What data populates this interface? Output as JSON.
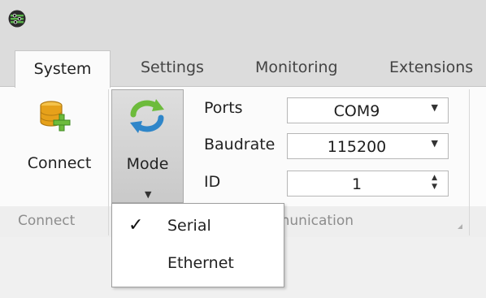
{
  "tabs": [
    {
      "label": "System",
      "active": true
    },
    {
      "label": "Settings",
      "active": false
    },
    {
      "label": "Monitoring",
      "active": false
    },
    {
      "label": "Extensions",
      "active": false
    }
  ],
  "ribbon": {
    "connect_label": "Connect",
    "mode_label": "Mode",
    "fields": {
      "ports": {
        "label": "Ports",
        "value": "COM9"
      },
      "baudrate": {
        "label": "Baudrate",
        "value": "115200"
      },
      "id": {
        "label": "ID",
        "value": "1"
      }
    },
    "groups": {
      "connect": "Connect",
      "communication": "Communication"
    }
  },
  "mode_menu": {
    "items": [
      {
        "label": "Serial",
        "checked": true
      },
      {
        "label": "Ethernet",
        "checked": false
      }
    ]
  },
  "icons": {
    "app": "app-logo-icon",
    "connect": "database-add-icon",
    "mode": "refresh-cycle-icon",
    "check": "checkmark-icon"
  },
  "colors": {
    "accent_green": "#6dbb3c",
    "database_gold": "#e6a11a",
    "mode_blue": "#2f86c9"
  }
}
